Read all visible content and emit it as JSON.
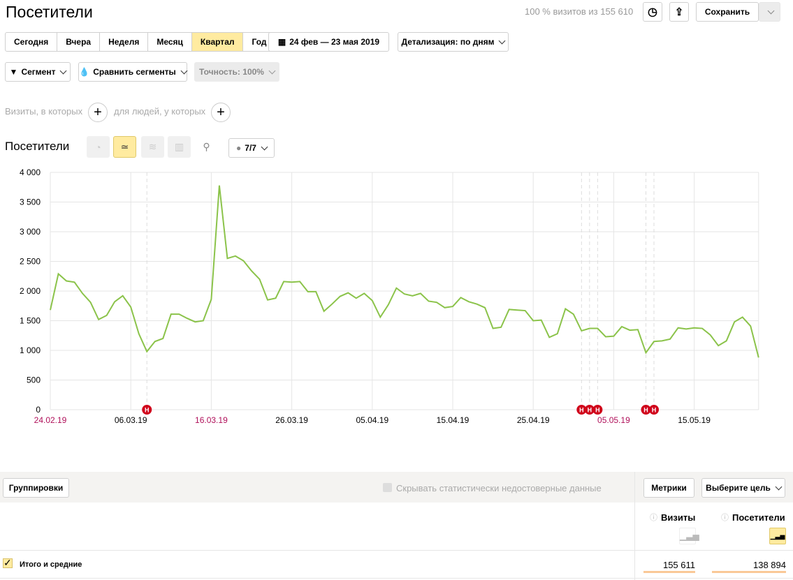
{
  "header": {
    "title": "Посетители",
    "sample_info": "100 % визитов из 155 610",
    "save_label": "Сохранить"
  },
  "periods": [
    {
      "label": "Сегодня"
    },
    {
      "label": "Вчера"
    },
    {
      "label": "Неделя"
    },
    {
      "label": "Месяц"
    },
    {
      "label": "Квартал",
      "active": true
    },
    {
      "label": "Год"
    }
  ],
  "date_range": "24 фев — 23 мая 2019",
  "detail": "Детализация: по дням",
  "filters": {
    "segment": "Сегмент",
    "compare": "Сравнить сегменты",
    "accuracy": "Точность: 100%"
  },
  "conditions": {
    "visits": "Визиты, в которых",
    "people": "для людей, у которых"
  },
  "chart_header": {
    "title": "Посетители",
    "annotations": "7/7",
    "active_type": "line"
  },
  "chart_data": {
    "type": "line",
    "ylim": [
      0,
      4000
    ],
    "yticks": [
      "0",
      "500",
      "1 000",
      "1 500",
      "2 000",
      "2 500",
      "3 000",
      "3 500",
      "4 000"
    ],
    "xticks": [
      {
        "label": "24.02.19",
        "day": 0,
        "weekend": true
      },
      {
        "label": "06.03.19",
        "day": 10
      },
      {
        "label": "16.03.19",
        "day": 20,
        "weekend": true
      },
      {
        "label": "26.03.19",
        "day": 30
      },
      {
        "label": "05.04.19",
        "day": 40
      },
      {
        "label": "15.04.19",
        "day": 50
      },
      {
        "label": "25.04.19",
        "day": 60
      },
      {
        "label": "05.05.19",
        "day": 70,
        "weekend": true
      },
      {
        "label": "15.05.19",
        "day": 80
      }
    ],
    "x_start": "24.02.19",
    "x_end": "23.05.19",
    "grid": true,
    "color": "#8bc34a",
    "values": [
      1680,
      2290,
      2170,
      2150,
      1960,
      1810,
      1520,
      1590,
      1820,
      1920,
      1730,
      1280,
      980,
      1150,
      1200,
      1610,
      1610,
      1540,
      1480,
      1500,
      1860,
      3780,
      2550,
      2590,
      2510,
      2340,
      2200,
      1850,
      1880,
      2160,
      2150,
      2160,
      1990,
      1990,
      1660,
      1780,
      1910,
      1970,
      1880,
      1960,
      1840,
      1560,
      1770,
      2050,
      1950,
      1920,
      1960,
      1830,
      1810,
      1720,
      1740,
      1890,
      1820,
      1780,
      1720,
      1370,
      1390,
      1690,
      1680,
      1670,
      1500,
      1510,
      1220,
      1280,
      1700,
      1610,
      1330,
      1370,
      1370,
      1230,
      1240,
      1400,
      1340,
      1350,
      960,
      1150,
      1160,
      1190,
      1380,
      1360,
      1380,
      1370,
      1260,
      1080,
      1160,
      1480,
      1560,
      1410,
      880
    ],
    "holidays": [
      {
        "day": 12,
        "label": "Н"
      },
      {
        "day": 66,
        "label": "Н"
      },
      {
        "day": 67,
        "label": "Н"
      },
      {
        "day": 68,
        "label": "Н"
      },
      {
        "day": 74,
        "label": "Н"
      },
      {
        "day": 75,
        "label": "Н"
      }
    ]
  },
  "table": {
    "groupings": "Группировки",
    "hide_unreliable": "Скрывать статистически недостоверные данные",
    "metrics": "Метрики",
    "goal": "Выберите цель",
    "columns": [
      {
        "label": "Визиты"
      },
      {
        "label": "Посетители",
        "active": true
      }
    ],
    "total_row": {
      "label": "Итого и средние",
      "values": [
        "155 611",
        "138 894"
      ]
    }
  }
}
